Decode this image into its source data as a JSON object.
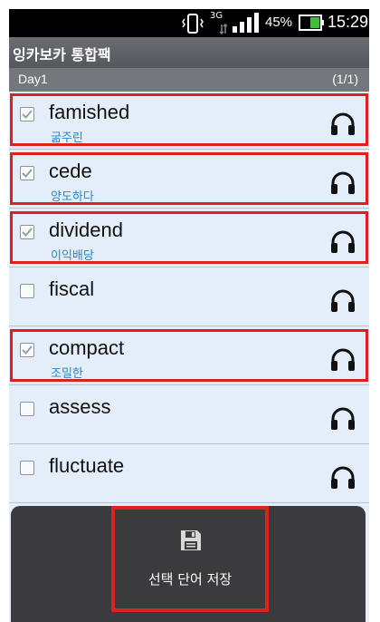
{
  "status_bar": {
    "network": "3G",
    "battery": "45%",
    "time": "15:29",
    "icons": [
      "vibrate-icon",
      "transfer-arrows-icon",
      "signal-icon",
      "battery-icon"
    ]
  },
  "header": {
    "title": "잉카보카 통합팩",
    "day": "Day1",
    "page": "(1/1)"
  },
  "words": [
    {
      "word": "famished",
      "meaning": "굶주린",
      "checked": true,
      "highlighted": true
    },
    {
      "word": "cede",
      "meaning": "양도하다",
      "checked": true,
      "highlighted": true
    },
    {
      "word": "dividend",
      "meaning": "이익배당",
      "checked": true,
      "highlighted": true
    },
    {
      "word": "fiscal",
      "meaning": "",
      "checked": false,
      "highlighted": false
    },
    {
      "word": "compact",
      "meaning": "조밀한",
      "checked": true,
      "highlighted": true
    },
    {
      "word": "assess",
      "meaning": "",
      "checked": false,
      "highlighted": false
    },
    {
      "word": "fluctuate",
      "meaning": "",
      "checked": false,
      "highlighted": false
    }
  ],
  "popup": {
    "save_label": "선택 단어 저장",
    "icon": "floppy-disk-icon"
  },
  "colors": {
    "list_bg": "#e3eefa",
    "highlight": "#e0201d",
    "meaning_text": "#2a86c8",
    "popup_bg": "#3b3b3d"
  }
}
